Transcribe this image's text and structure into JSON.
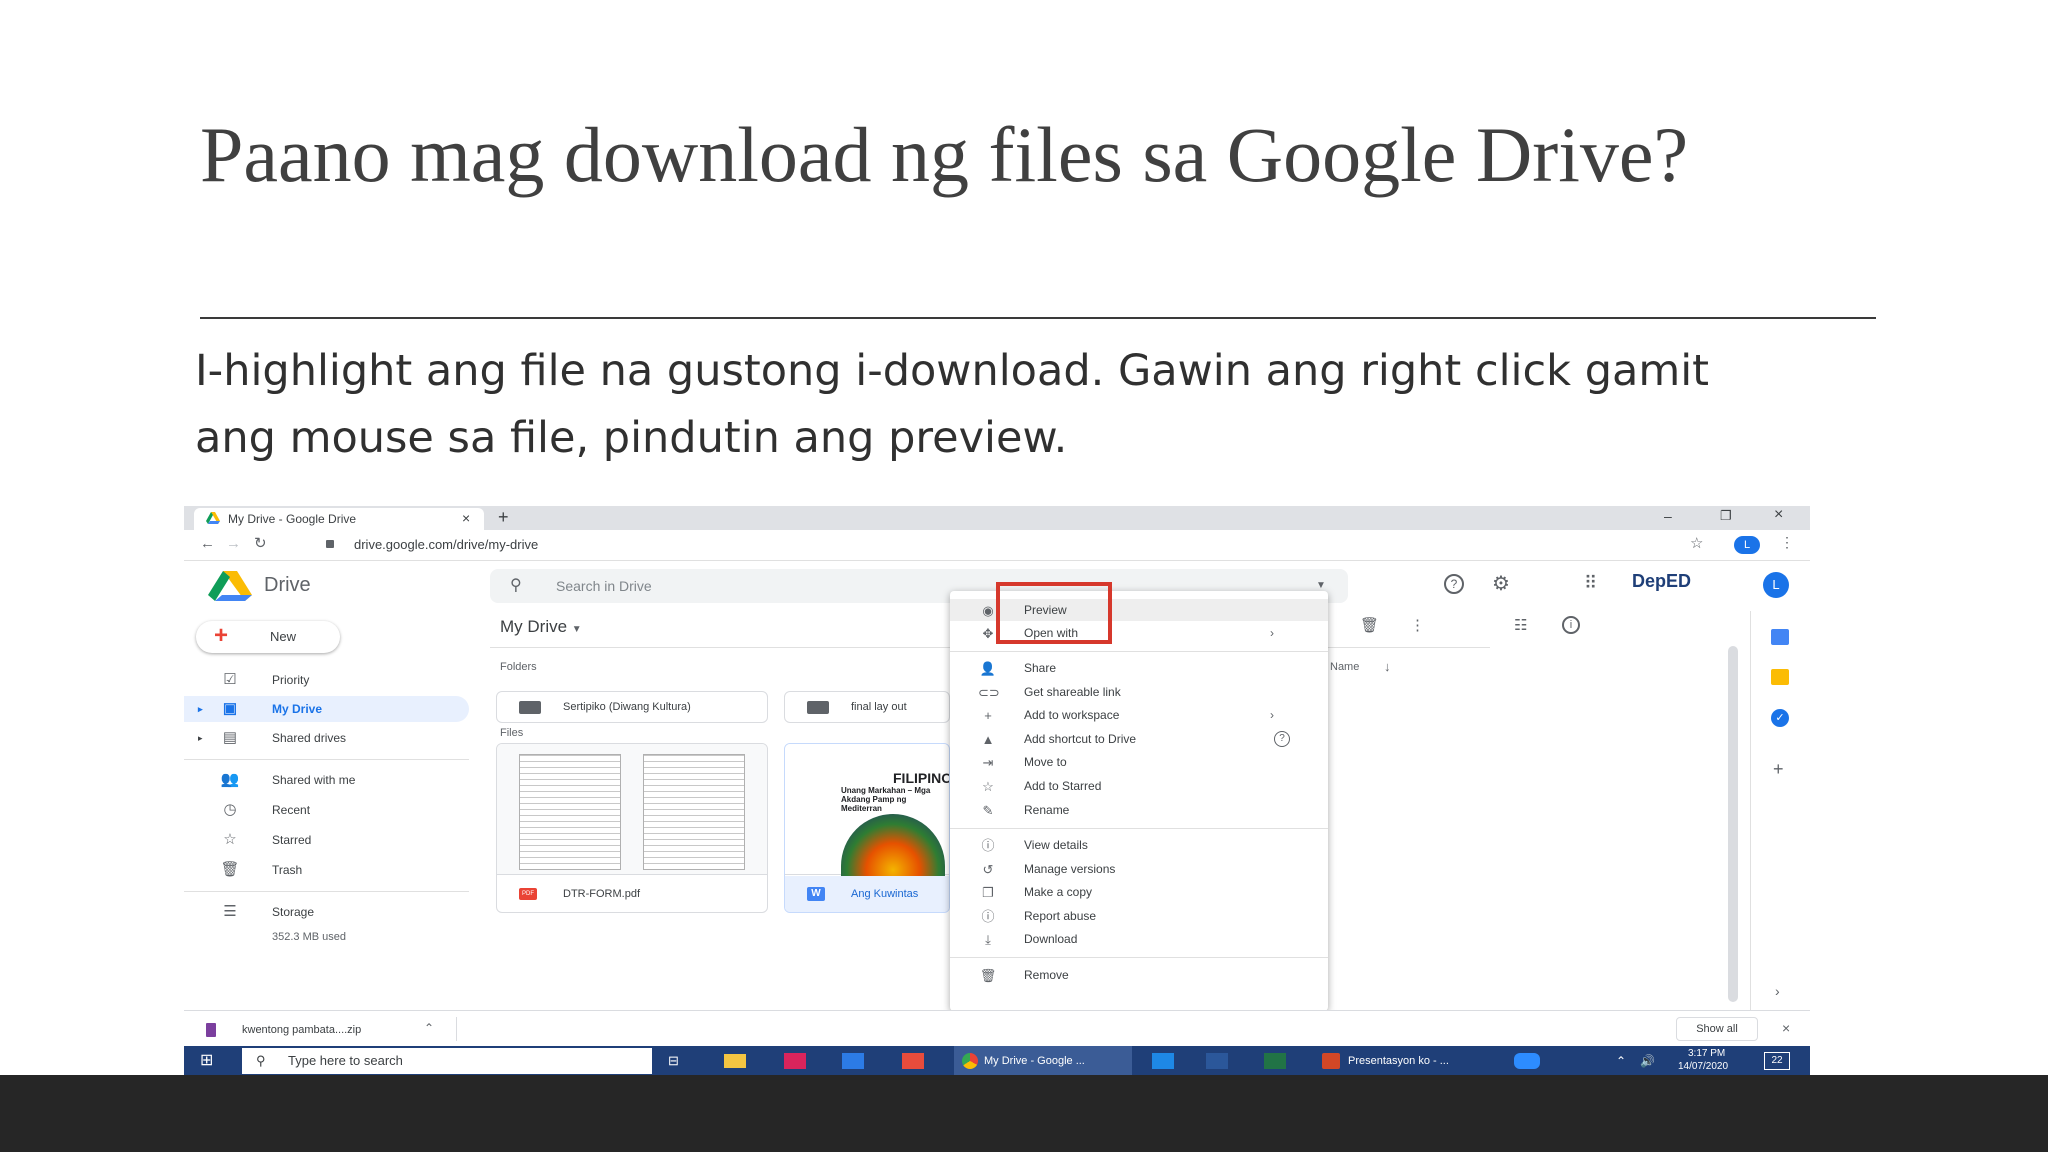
{
  "slide": {
    "title": "Paano mag download ng files sa Google Drive?",
    "body": "I-highlight ang file na gustong i-download. Gawin ang right click gamit ang mouse sa file, pindutin ang preview."
  },
  "browser": {
    "tab_title": "My Drive - Google Drive",
    "tab_close": "×",
    "new_tab": "+",
    "url": "drive.google.com/drive/my-drive",
    "window_controls": [
      "–",
      "❐",
      "×"
    ],
    "profile_initial": "L"
  },
  "drive": {
    "app_name": "Drive",
    "search_placeholder": "Search in Drive",
    "new_button": "New",
    "brand": "DepED",
    "account_initial": "L",
    "nav": [
      {
        "icon": "priority-icon",
        "label": "Priority"
      },
      {
        "icon": "my-drive-icon",
        "label": "My Drive"
      },
      {
        "icon": "shared-drives-icon",
        "label": "Shared drives"
      },
      {
        "icon": "shared-with-me-icon",
        "label": "Shared with me"
      },
      {
        "icon": "recent-icon",
        "label": "Recent"
      },
      {
        "icon": "starred-icon",
        "label": "Starred"
      },
      {
        "icon": "trash-icon",
        "label": "Trash"
      },
      {
        "icon": "storage-icon",
        "label": "Storage"
      }
    ],
    "storage_used": "352.3 MB used",
    "breadcrumb": "My Drive",
    "folders_header": "Folders",
    "files_header": "Files",
    "sort_label": "Name",
    "folders": [
      "Sertipiko (Diwang Kultura)",
      "final lay out"
    ],
    "files": [
      {
        "name": "DTR-FORM.pdf",
        "badge": "PDF"
      },
      {
        "name": "Ang Kuwintas",
        "badge": "W",
        "thumb_text": "FILIPINO",
        "thumb_sub": "Unang Markahan – Mga Akdang Pamp ng Mediterran"
      }
    ]
  },
  "context_menu": {
    "items": [
      {
        "icon": "eye-icon",
        "label": "Preview",
        "arrow": ""
      },
      {
        "icon": "open-with-icon",
        "label": "Open with",
        "arrow": "›"
      },
      {
        "icon": "share-icon",
        "label": "Share",
        "arrow": ""
      },
      {
        "icon": "link-icon",
        "label": "Get shareable link",
        "arrow": ""
      },
      {
        "icon": "plus-icon",
        "label": "Add to workspace",
        "arrow": "›"
      },
      {
        "icon": "drive-shortcut-icon",
        "label": "Add shortcut to Drive",
        "arrow": "?"
      },
      {
        "icon": "move-icon",
        "label": "Move to",
        "arrow": ""
      },
      {
        "icon": "star-icon",
        "label": "Add to Starred",
        "arrow": ""
      },
      {
        "icon": "pencil-icon",
        "label": "Rename",
        "arrow": ""
      },
      {
        "icon": "info-icon",
        "label": "View details",
        "arrow": ""
      },
      {
        "icon": "history-icon",
        "label": "Manage versions",
        "arrow": ""
      },
      {
        "icon": "copy-icon",
        "label": "Make a copy",
        "arrow": ""
      },
      {
        "icon": "report-icon",
        "label": "Report abuse",
        "arrow": ""
      },
      {
        "icon": "download-icon",
        "label": "Download",
        "arrow": ""
      },
      {
        "icon": "trash-icon",
        "label": "Remove",
        "arrow": ""
      }
    ]
  },
  "downloads": {
    "file": "kwentong pambata....zip",
    "show_all": "Show all"
  },
  "taskbar": {
    "search_placeholder": "Type here to search",
    "chrome_item": "My Drive - Google ...",
    "ppt_item": "Presentasyon ko - ...",
    "time": "3:17 PM",
    "date": "14/07/2020",
    "notification_count": "22"
  },
  "colors": {
    "highlight_box": "#d6382c",
    "taskbar": "#1f3f78",
    "selected_nav": "#e8f0fe",
    "accent_blue": "#1a73e8"
  }
}
